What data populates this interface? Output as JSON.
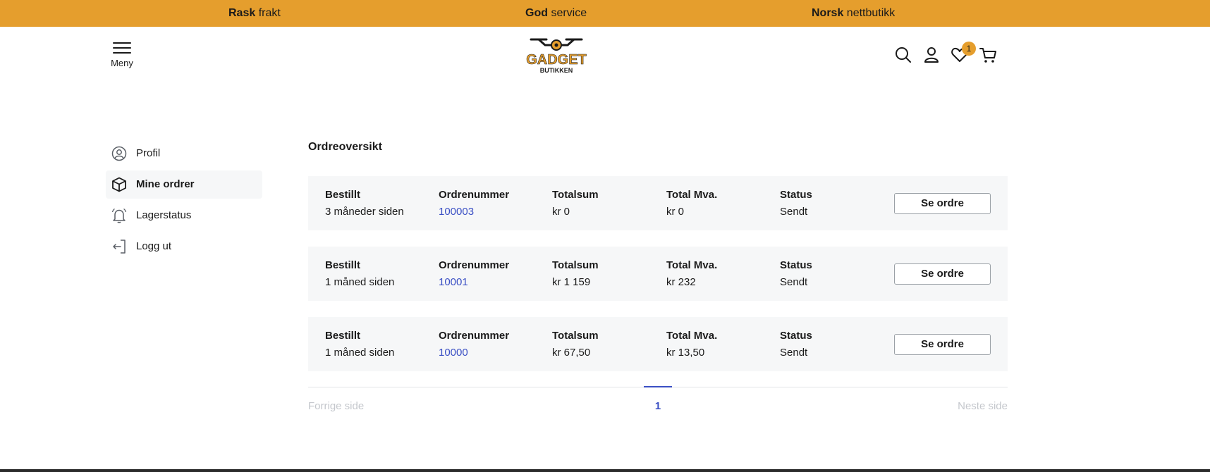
{
  "topbar": {
    "items": [
      {
        "bold": "Rask",
        "rest": " frakt"
      },
      {
        "bold": "God",
        "rest": " service"
      },
      {
        "bold": "Norsk",
        "rest": " nettbutikk"
      }
    ],
    "color": "#e59e2d"
  },
  "header": {
    "menu_label": "Meny",
    "logo_text": "GADGET",
    "logo_subtext": "BUTIKKEN",
    "wishlist_count": "1"
  },
  "sidebar": {
    "items": [
      {
        "label": "Profil",
        "icon": "user-circle-icon",
        "active": false
      },
      {
        "label": "Mine ordrer",
        "icon": "box-icon",
        "active": true
      },
      {
        "label": "Lagerstatus",
        "icon": "bell-icon",
        "active": false
      },
      {
        "label": "Logg ut",
        "icon": "logout-icon",
        "active": false
      }
    ]
  },
  "main": {
    "title": "Ordreoversikt",
    "columns": {
      "ordered": "Bestillt",
      "order_number": "Ordrenummer",
      "total": "Totalsum",
      "vat": "Total Mva.",
      "status": "Status"
    },
    "view_button_label": "Se ordre",
    "orders": [
      {
        "ordered": "3 måneder siden",
        "order_number": "100003",
        "total": "kr 0",
        "vat": "kr 0",
        "status": "Sendt"
      },
      {
        "ordered": "1 måned siden",
        "order_number": "10001",
        "total": "kr 1 159",
        "vat": "kr 232",
        "status": "Sendt"
      },
      {
        "ordered": "1 måned siden",
        "order_number": "10000",
        "total": "kr 67,50",
        "vat": "kr 13,50",
        "status": "Sendt"
      }
    ]
  },
  "pagination": {
    "prev_label": "Forrige side",
    "current_page": "1",
    "next_label": "Neste side"
  },
  "colors": {
    "accent": "#e59e2d",
    "link": "#3a4fc4",
    "card_bg": "#f6f7f8"
  }
}
